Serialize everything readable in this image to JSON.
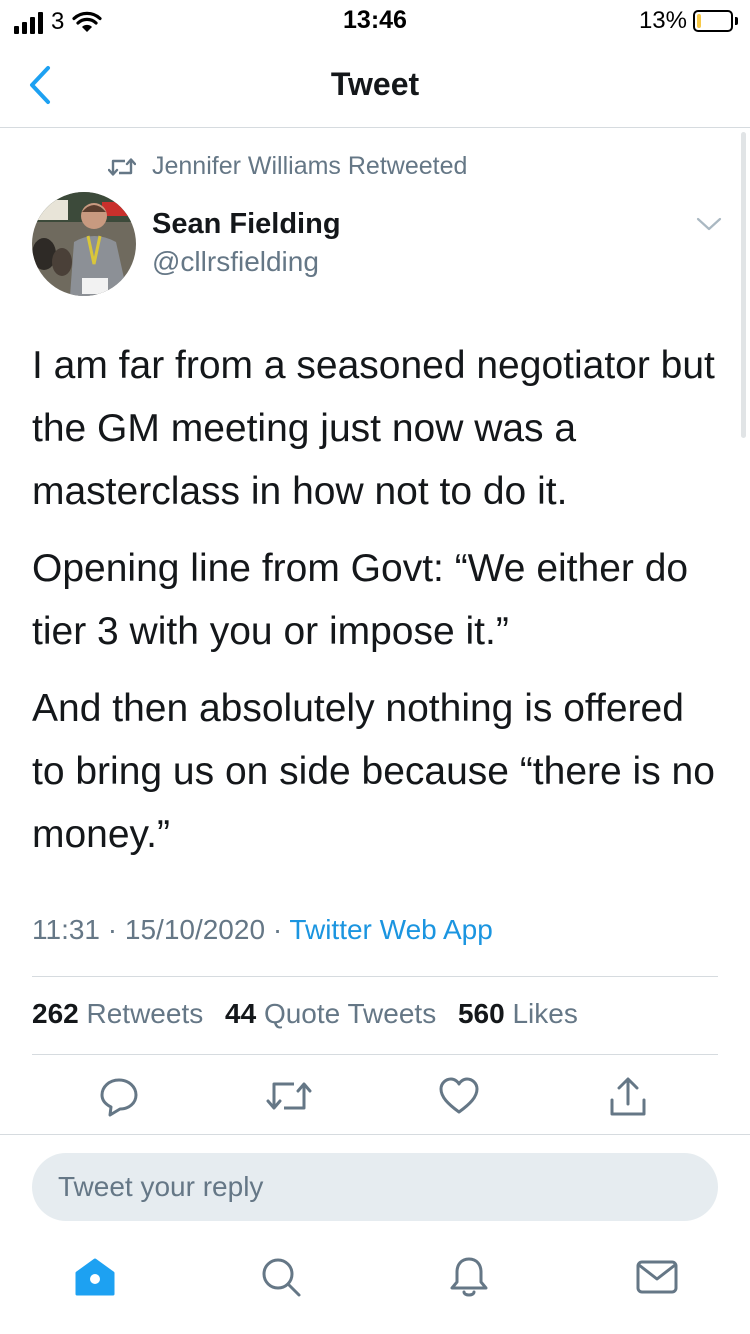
{
  "status_bar": {
    "carrier": "3",
    "time": "13:46",
    "battery_percent": "13%",
    "battery_level": 0.13,
    "battery_color": "#f7c948"
  },
  "nav": {
    "title": "Tweet",
    "back_icon": "chevron-left-icon"
  },
  "tweet": {
    "retweeted_by": "Jennifer Williams Retweeted",
    "author": {
      "name": "Sean Fielding",
      "handle": "@cllrsfielding"
    },
    "paragraphs": [
      "I am far from a seasoned negotiator but the GM meeting just now was a masterclass in how not to do it.",
      "Opening line from Govt: “We either do tier 3 with you or impose it.”",
      "And then absolutely nothing is offered to bring us on side because “there is no money.”"
    ],
    "time": "11:31",
    "date": "15/10/2020",
    "separator": "·",
    "source": "Twitter Web App",
    "stats": {
      "retweets_count": "262",
      "retweets_label": "Retweets",
      "quotes_count": "44",
      "quotes_label": "Quote Tweets",
      "likes_count": "560",
      "likes_label": "Likes"
    }
  },
  "actions": [
    "reply-icon",
    "retweet-icon",
    "like-icon",
    "share-icon"
  ],
  "reply": {
    "placeholder": "Tweet your reply"
  },
  "tab_bar": [
    "home-icon",
    "search-icon",
    "notifications-icon",
    "messages-icon"
  ],
  "colors": {
    "accent": "#1da1f2",
    "link": "#1b95e0",
    "secondary_text": "#657786",
    "divider": "#d6dbdf"
  }
}
